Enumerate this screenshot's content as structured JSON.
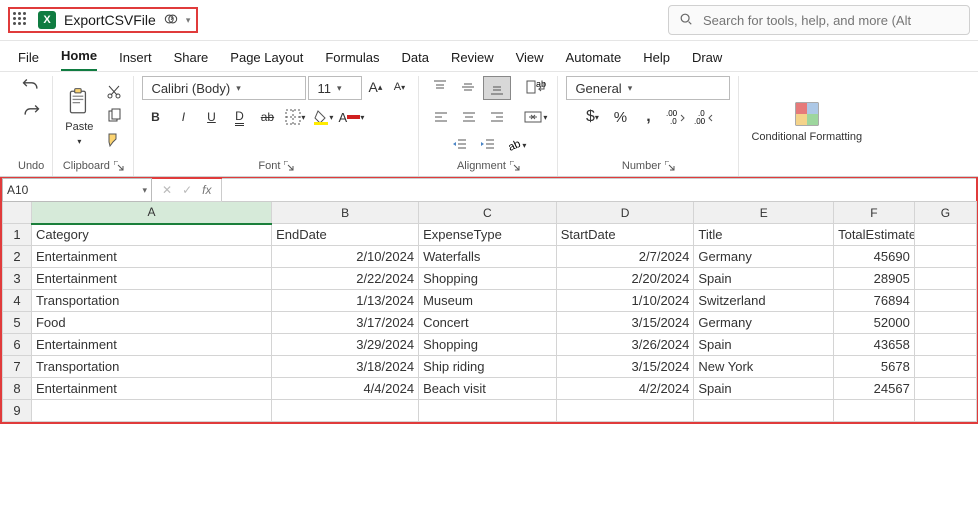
{
  "header": {
    "doc_name": "ExportCSVFile",
    "excel_letter": "X",
    "search_placeholder": "Search for tools, help, and more (Alt"
  },
  "ribbon_tabs": [
    "File",
    "Home",
    "Insert",
    "Share",
    "Page Layout",
    "Formulas",
    "Data",
    "Review",
    "View",
    "Automate",
    "Help",
    "Draw"
  ],
  "ribbon_active": "Home",
  "ribbon": {
    "undo_label": "Undo",
    "clipboard_label": "Clipboard",
    "paste_label": "Paste",
    "font_label": "Font",
    "font_name": "Calibri (Body)",
    "font_size": "11",
    "alignment_label": "Alignment",
    "number_label": "Number",
    "number_format": "General",
    "cond_format": "Conditional Formatting"
  },
  "name_box": "A10",
  "columns": [
    "A",
    "B",
    "C",
    "D",
    "E",
    "F",
    "G"
  ],
  "chart_data": {
    "type": "table",
    "headers": [
      "Category",
      "EndDate",
      "ExpenseType",
      "StartDate",
      "Title",
      "TotalEstimatedCost"
    ],
    "rows": [
      [
        "Entertainment",
        "2/10/2024",
        "Waterfalls",
        "2/7/2024",
        "Germany",
        "45690"
      ],
      [
        "Entertainment",
        "2/22/2024",
        "Shopping",
        "2/20/2024",
        "Spain",
        "28905"
      ],
      [
        "Transportation",
        "1/13/2024",
        "Museum",
        "1/10/2024",
        "Switzerland",
        "76894"
      ],
      [
        "Food",
        "3/17/2024",
        "Concert",
        "3/15/2024",
        "Germany",
        "52000"
      ],
      [
        "Entertainment",
        "3/29/2024",
        "Shopping",
        "3/26/2024",
        "Spain",
        "43658"
      ],
      [
        "Transportation",
        "3/18/2024",
        "Ship riding",
        "3/15/2024",
        "New York",
        "5678"
      ],
      [
        "Entertainment",
        "4/4/2024",
        "Beach visit",
        "4/2/2024",
        "Spain",
        "24567"
      ]
    ]
  }
}
